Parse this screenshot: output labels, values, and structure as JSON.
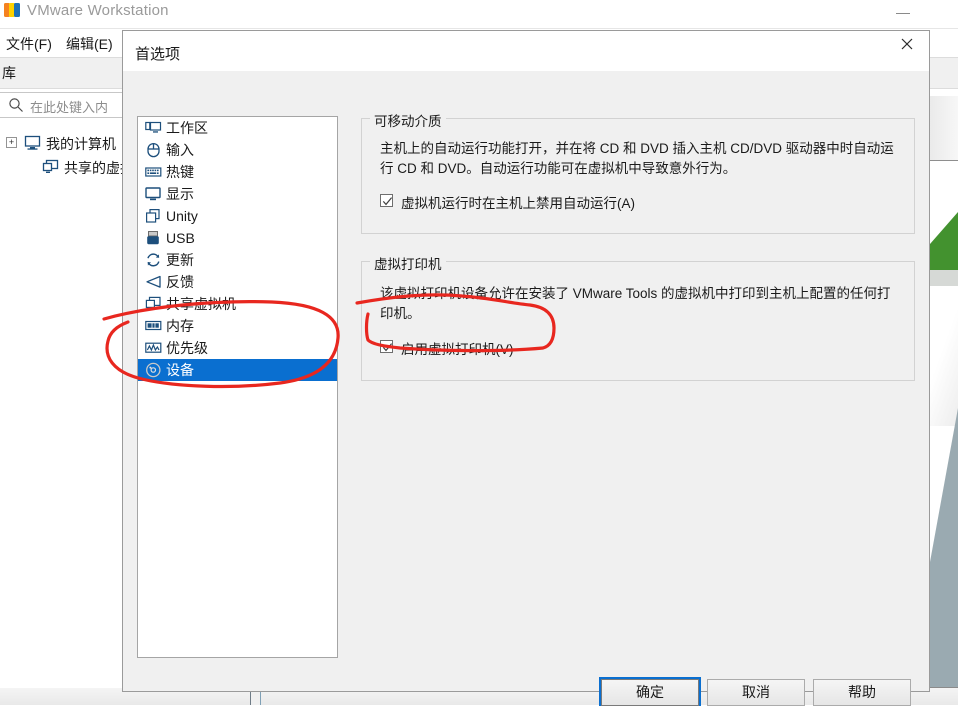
{
  "background": {
    "app_title": "VMware Workstation",
    "logo_icon": "vmware-logo-icon",
    "minimize_icon": "minimize-icon",
    "menus": [
      {
        "label": "文件(F)"
      },
      {
        "label": "编辑(E)"
      }
    ],
    "library_label": "库",
    "search": {
      "icon": "search-icon",
      "placeholder": "在此处键入内"
    },
    "tree": [
      {
        "label": "我的计算机",
        "icon": "computer-icon",
        "expander": "+"
      },
      {
        "label": "共享的虚拟",
        "icon": "shared-vm-icon",
        "expander": ""
      }
    ]
  },
  "dialog": {
    "title": "首选项",
    "close_icon": "close-icon",
    "sidebar": {
      "items": [
        {
          "label": "工作区",
          "icon": "workspace-icon",
          "selected": false
        },
        {
          "label": "输入",
          "icon": "mouse-icon",
          "selected": false
        },
        {
          "label": "热键",
          "icon": "keyboard-icon",
          "selected": false
        },
        {
          "label": "显示",
          "icon": "display-icon",
          "selected": false
        },
        {
          "label": "Unity",
          "icon": "unity-icon",
          "selected": false
        },
        {
          "label": "USB",
          "icon": "usb-icon",
          "selected": false
        },
        {
          "label": "更新",
          "icon": "refresh-icon",
          "selected": false
        },
        {
          "label": "反馈",
          "icon": "megaphone-icon",
          "selected": false
        },
        {
          "label": "共享虚拟机",
          "icon": "shared-vm-icon",
          "selected": false
        },
        {
          "label": "内存",
          "icon": "memory-icon",
          "selected": false
        },
        {
          "label": "优先级",
          "icon": "priority-icon",
          "selected": false
        },
        {
          "label": "设备",
          "icon": "device-disc-icon",
          "selected": true
        }
      ]
    },
    "groups": [
      {
        "title": "可移动介质",
        "description": "主机上的自动运行功能打开，并在将 CD 和 DVD 插入主机 CD/DVD 驱动器中时自动运行 CD 和 DVD。自动运行功能可在虚拟机中导致意外行为。",
        "checkbox": {
          "label": "虚拟机运行时在主机上禁用自动运行(A)",
          "checked": true
        }
      },
      {
        "title": "虚拟打印机",
        "description": "该虚拟打印机设备允许在安装了 VMware Tools 的虚拟机中打印到主机上配置的任何打印机。",
        "checkbox": {
          "label": "启用虚拟打印机(V)",
          "checked": true
        }
      }
    ],
    "buttons": {
      "ok": "确定",
      "cancel": "取消",
      "help": "帮助"
    }
  },
  "annotations": {
    "color": "#e8271f",
    "shapes": [
      {
        "name": "ellipse-around-device-item"
      },
      {
        "name": "rounded-rect-around-enable-virtual-printer-checkbox"
      }
    ]
  },
  "colors": {
    "selection_blue": "#0a6fd0",
    "annotation_red": "#e8271f",
    "dialog_face": "#f0f0f0",
    "graphic_green": "#43922f",
    "graphic_slate": "#9aaab1"
  }
}
